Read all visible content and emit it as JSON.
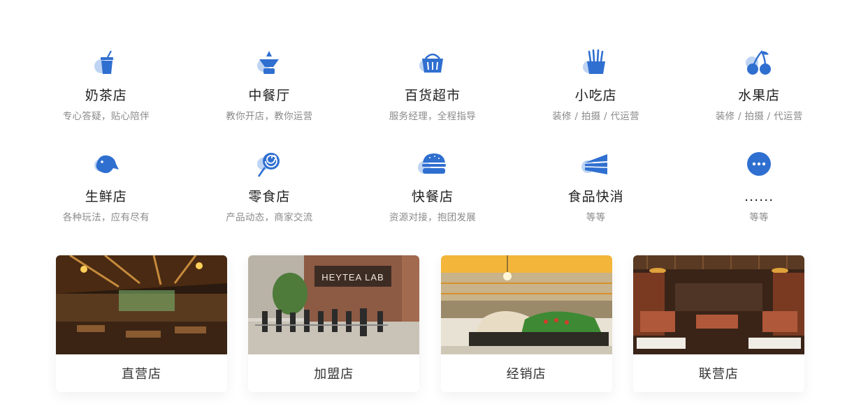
{
  "colors": {
    "accent": "#2f6fd0",
    "accent_light": "#bfd4f3",
    "subtitle": "#8a8a8a"
  },
  "categories": [
    {
      "icon": "milk-tea-icon",
      "title": "奶茶店",
      "subtitle": "专心答疑，贴心陪伴"
    },
    {
      "icon": "chinese-food-icon",
      "title": "中餐厅",
      "subtitle": "教你开店，教你运营"
    },
    {
      "icon": "shopping-basket-icon",
      "title": "百货超市",
      "subtitle": "服务经理，全程指导"
    },
    {
      "icon": "fries-icon",
      "title": "小吃店",
      "subtitle": "装修 / 拍摄 / 代运营"
    },
    {
      "icon": "cherry-icon",
      "title": "水果店",
      "subtitle": "装修 / 拍摄 / 代运营"
    },
    {
      "icon": "fish-icon",
      "title": "生鲜店",
      "subtitle": "各种玩法，应有尽有"
    },
    {
      "icon": "lollipop-icon",
      "title": "零食店",
      "subtitle": "产品动态，商家交流"
    },
    {
      "icon": "burger-icon",
      "title": "快餐店",
      "subtitle": "资源对接，抱团发展"
    },
    {
      "icon": "cake-icon",
      "title": "食品快消",
      "subtitle": "等等"
    },
    {
      "icon": "more-icon",
      "title": "......",
      "subtitle": "等等"
    }
  ],
  "stores": [
    {
      "label": "直营店",
      "photo": "restaurant-interior-photo"
    },
    {
      "label": "加盟店",
      "photo": "storefront-queue-photo"
    },
    {
      "label": "经销店",
      "photo": "supermarket-produce-photo"
    },
    {
      "label": "联营店",
      "photo": "dining-hall-photo"
    }
  ]
}
